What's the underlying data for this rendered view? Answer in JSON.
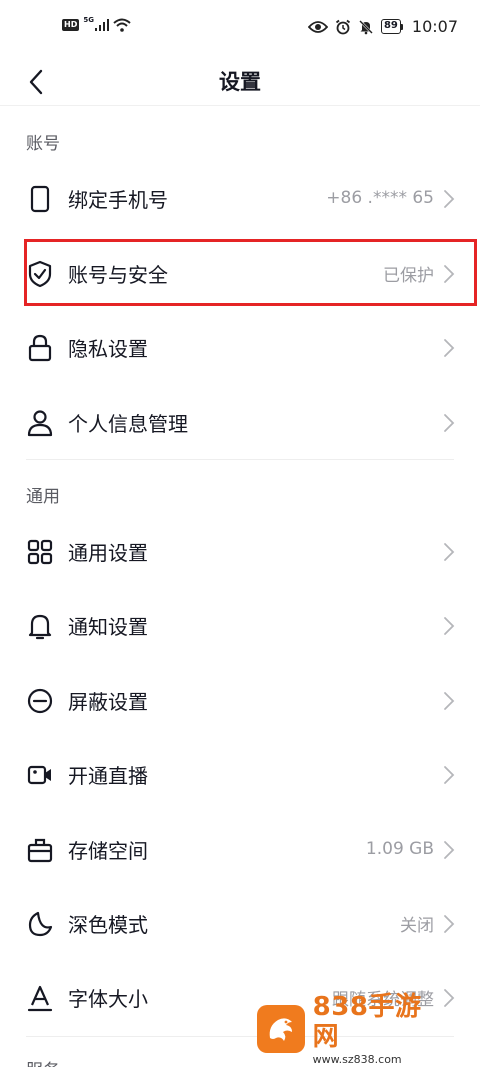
{
  "status_bar": {
    "hd": "HD",
    "network": "5G",
    "battery": "89",
    "time": "10:07"
  },
  "nav": {
    "title": "设置"
  },
  "sections": {
    "account": "账号",
    "general": "通用",
    "service": "服务"
  },
  "rows": {
    "bind_phone": {
      "label": "绑定手机号",
      "value": "+86 .**** 65",
      "icon": "phone-icon"
    },
    "account_security": {
      "label": "账号与安全",
      "value": "已保护",
      "icon": "shield-check-icon"
    },
    "privacy": {
      "label": "隐私设置",
      "icon": "lock-icon"
    },
    "personal_info": {
      "label": "个人信息管理",
      "icon": "person-icon"
    },
    "general_settings": {
      "label": "通用设置",
      "icon": "grid-icon"
    },
    "notifications": {
      "label": "通知设置",
      "icon": "bell-icon"
    },
    "block": {
      "label": "屏蔽设置",
      "icon": "block-icon"
    },
    "live": {
      "label": "开通直播",
      "icon": "video-camera-icon"
    },
    "storage": {
      "label": "存储空间",
      "value": "1.09 GB",
      "icon": "briefcase-icon"
    },
    "dark_mode": {
      "label": "深色模式",
      "value": "关闭",
      "icon": "moon-icon"
    },
    "font_size": {
      "label": "字体大小",
      "value": "跟随系统调整",
      "icon": "font-icon"
    }
  },
  "watermark": {
    "brand": "838手游网",
    "url": "www.sz838.com"
  },
  "colors": {
    "highlight": "#e52425",
    "secondary_text": "#9c9da3",
    "watermark_orange": "#e8741c"
  }
}
